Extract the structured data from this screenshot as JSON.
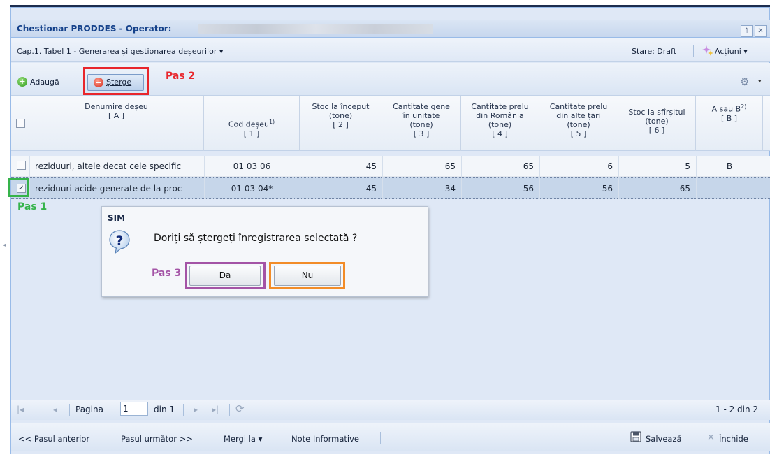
{
  "window": {
    "title": "Chestionar PRODDES - Operator:",
    "collapse_icon": "⇑",
    "close_icon": "✕"
  },
  "capbar": {
    "chapter_menu": "Cap.1. Tabel 1 - Generarea și gestionarea deșeurilor",
    "chapter_arrow": "▾",
    "status": "Stare: Draft",
    "actions_menu": "Acțiuni"
  },
  "toolbar": {
    "add_label": "Adaugă",
    "delete_label": "Șterge",
    "step2": "Pas 2",
    "settings_icon": "⚙"
  },
  "grid": {
    "headers": [
      {
        "line1": "Denumire deșeu",
        "line2": "[ A ]"
      },
      {
        "line1": "Cod deșeu",
        "sup": "1)",
        "line2": "[ 1 ]"
      },
      {
        "line1": "Stoc la început",
        "line2": "(tone)",
        "line3": "[ 2 ]"
      },
      {
        "line1": "Cantitate gene",
        "line2": "în unitate",
        "line3": "(tone)",
        "line4": "[ 3 ]"
      },
      {
        "line1": "Cantitate prelu",
        "line2": "din România",
        "line3": "(tone)",
        "line4": "[ 4 ]"
      },
      {
        "line1": "Cantitate prelu",
        "line2": "din alte țări",
        "line3": "(tone)",
        "line4": "[ 5 ]"
      },
      {
        "line1": "Stoc la sfîrșitul",
        "line2": "(tone)",
        "line3": "[ 6 ]"
      },
      {
        "line1": "A sau B",
        "sup": "2)",
        "line2": "[ B ]"
      }
    ],
    "rows": [
      {
        "name": "reziduuri, altele decat cele specific",
        "code": "01 03 06",
        "c2": "45",
        "c3": "65",
        "c4": "65",
        "c5": "6",
        "c6": "5",
        "ab": "B"
      },
      {
        "name": "reziduuri acide generate de la proc",
        "code": "01 03 04*",
        "c2": "45",
        "c3": "34",
        "c4": "56",
        "c5": "56",
        "c6": "65",
        "ab": ""
      }
    ],
    "step1": "Pas 1"
  },
  "dialog": {
    "title": "SIM",
    "message": "Doriți să ștergeți înregistrarea selectată ?",
    "yes_label": "Da",
    "no_label": "Nu",
    "step3": "Pas 3"
  },
  "pager": {
    "page_label": "Pagina",
    "page_value": "1",
    "of_label": "din 1",
    "summary": "1 - 2 din 2"
  },
  "footer": {
    "prev_step": "<< Pasul anterior",
    "next_step": "Pasul următor >>",
    "goto": "Mergi la",
    "notes": "Note Informative",
    "save": "Salvează",
    "close": "Închide"
  },
  "colors": {
    "step1": "#35b34a",
    "step2": "#e8262c",
    "step3": "#a454a6",
    "no_highlight": "#f28c28",
    "selected_row": "#c6d6ea"
  }
}
